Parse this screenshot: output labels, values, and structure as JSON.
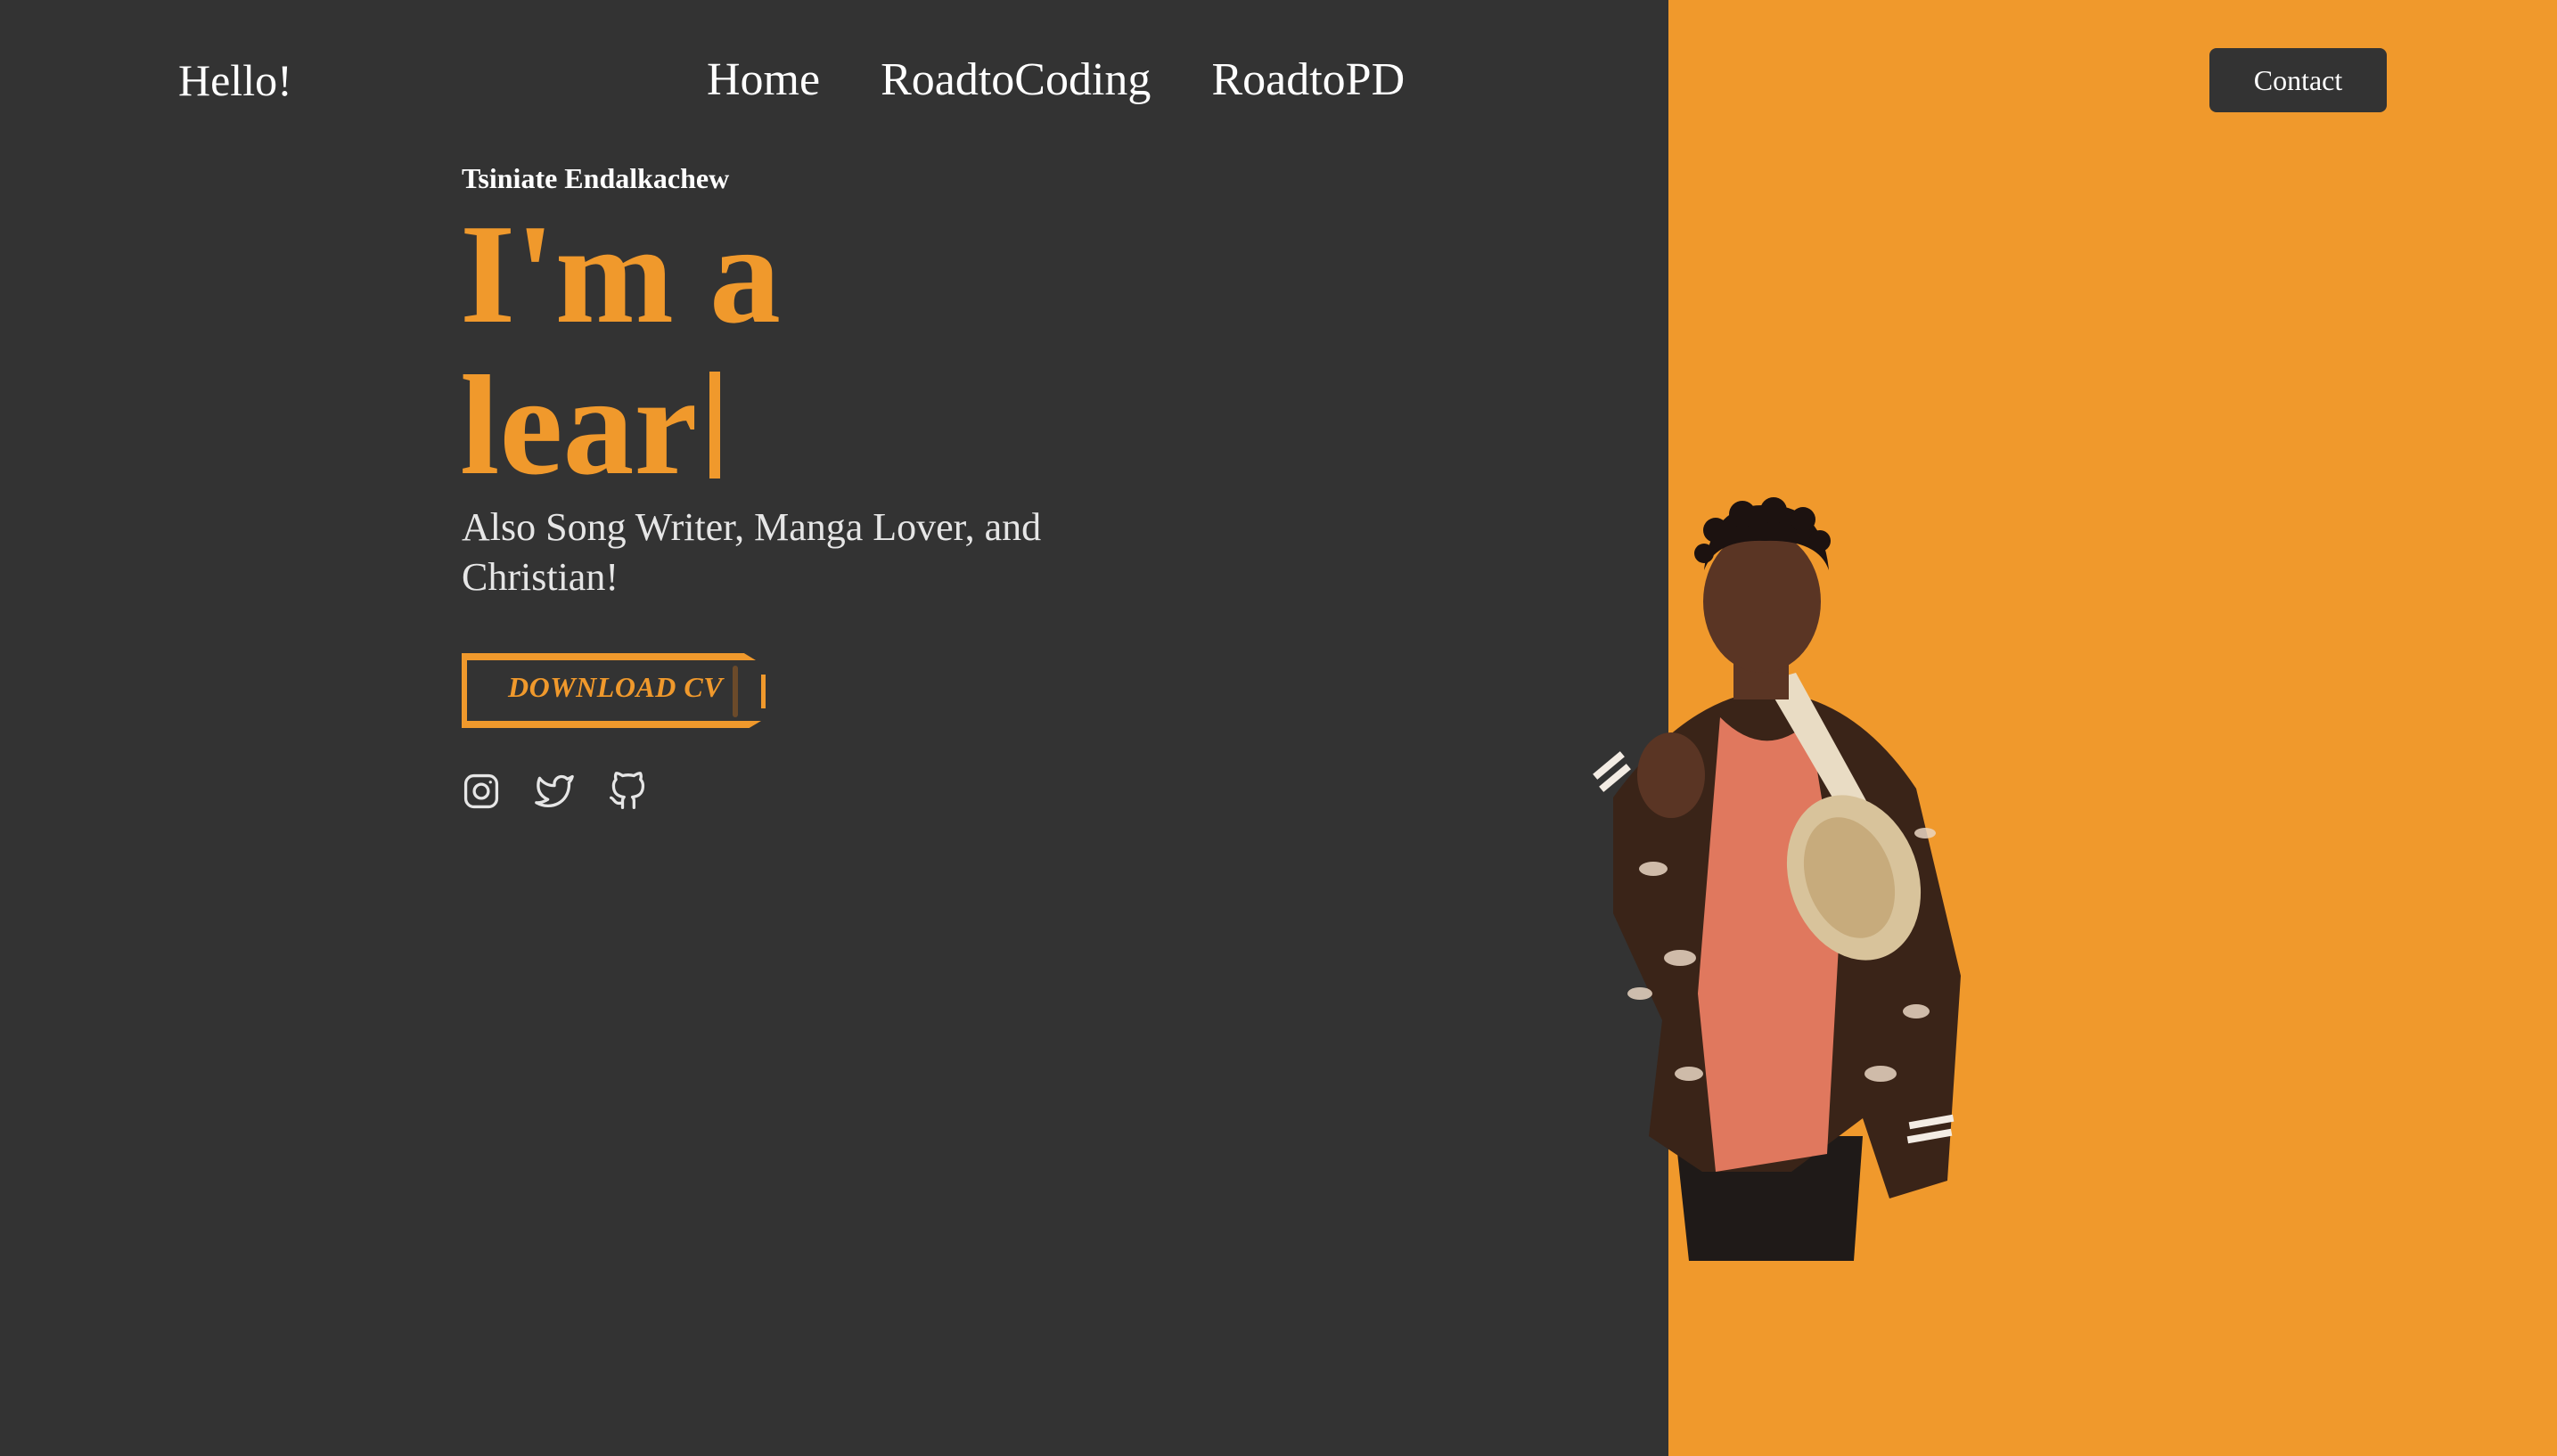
{
  "header": {
    "brand": "Hello!",
    "nav": [
      {
        "label": "Home"
      },
      {
        "label": "RoadtoCoding"
      },
      {
        "label": "RoadtoPD"
      }
    ],
    "contact_label": "Contact"
  },
  "hero": {
    "name": "Tsiniate Endalkachew",
    "headline_line1": "I'm a",
    "headline_line2": "lear",
    "subtitle": "Also Song Writer, Manga Lover, and Christian!",
    "cv_label": "DOWNLOAD CV"
  },
  "socials": [
    {
      "icon": "instagram-icon"
    },
    {
      "icon": "twitter-icon"
    },
    {
      "icon": "github-icon"
    }
  ],
  "colors": {
    "background": "#333333",
    "accent": "#F0992C",
    "text": "#ffffff"
  }
}
